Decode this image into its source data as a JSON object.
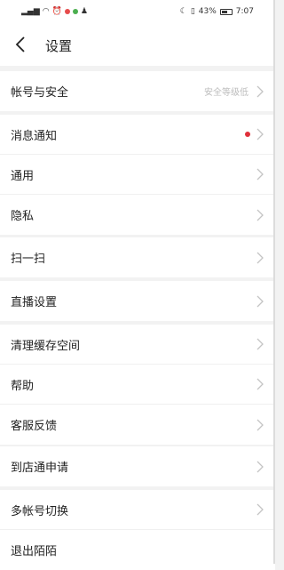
{
  "status_bar": {
    "battery": "43%",
    "time": "7:07"
  },
  "header": {
    "title": "设置"
  },
  "groups": [
    {
      "items": [
        {
          "label": "帐号与安全",
          "value": "安全等级低"
        }
      ]
    },
    {
      "items": [
        {
          "label": "消息通知"
        },
        {
          "label": "通用"
        },
        {
          "label": "隐私"
        }
      ]
    },
    {
      "items": [
        {
          "label": "扫一扫"
        }
      ]
    },
    {
      "items": [
        {
          "label": "直播设置"
        }
      ]
    },
    {
      "items": [
        {
          "label": "清理缓存空间"
        },
        {
          "label": "帮助"
        },
        {
          "label": "客服反馈"
        }
      ]
    },
    {
      "items": [
        {
          "label": "到店通申请"
        }
      ]
    },
    {
      "items": [
        {
          "label": "多帐号切换"
        },
        {
          "label": "退出陌陌"
        }
      ]
    }
  ]
}
